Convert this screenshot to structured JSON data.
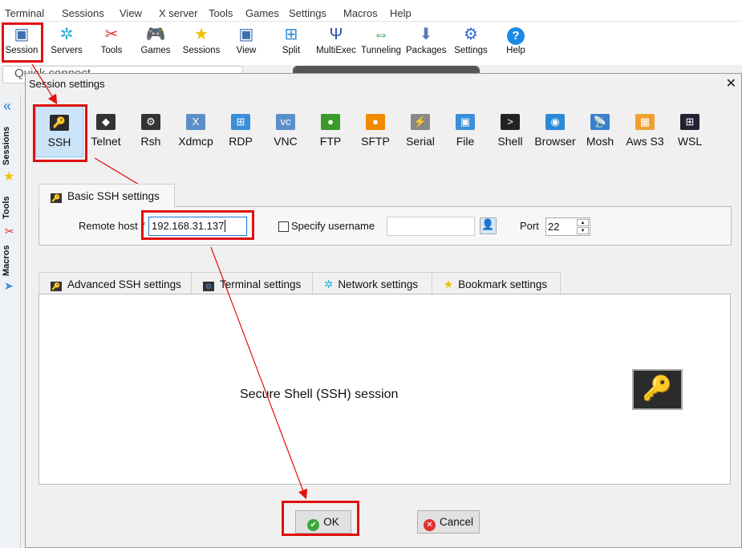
{
  "menu": [
    "Terminal",
    "Sessions",
    "View",
    "X server",
    "Tools",
    "Games",
    "Settings",
    "Macros",
    "Help"
  ],
  "toolbar": [
    {
      "label": "Session",
      "icon": "session-monitor-icon"
    },
    {
      "label": "Servers",
      "icon": "servers-icon"
    },
    {
      "label": "Tools",
      "icon": "tools-icon"
    },
    {
      "label": "Games",
      "icon": "gamepad-icon"
    },
    {
      "label": "Sessions",
      "icon": "star-icon"
    },
    {
      "label": "View",
      "icon": "view-icon"
    },
    {
      "label": "Split",
      "icon": "split-icon"
    },
    {
      "label": "MultiExec",
      "icon": "multiexec-icon"
    },
    {
      "label": "Tunneling",
      "icon": "tunneling-icon"
    },
    {
      "label": "Packages",
      "icon": "packages-icon"
    },
    {
      "label": "Settings",
      "icon": "settings-gears-icon"
    },
    {
      "label": "Help",
      "icon": "help-icon"
    }
  ],
  "quick_connect": "Quick connect...",
  "sidebar": {
    "sessions": "Sessions",
    "tools": "Tools",
    "macros": "Macros"
  },
  "dialog": {
    "title": "Session settings",
    "session_types": [
      {
        "label": "SSH",
        "color": "#2b2b2b",
        "glyph": "🔑"
      },
      {
        "label": "Telnet",
        "color": "#333",
        "glyph": "◆"
      },
      {
        "label": "Rsh",
        "color": "#333",
        "glyph": "⚙"
      },
      {
        "label": "Xdmcp",
        "color": "#5a8fc8",
        "glyph": "X"
      },
      {
        "label": "RDP",
        "color": "#3b8fd8",
        "glyph": "⊞"
      },
      {
        "label": "VNC",
        "color": "#5a8fc8",
        "glyph": "vc"
      },
      {
        "label": "FTP",
        "color": "#3a9a2a",
        "glyph": "●"
      },
      {
        "label": "SFTP",
        "color": "#f08a00",
        "glyph": "●"
      },
      {
        "label": "Serial",
        "color": "#888",
        "glyph": "⚡"
      },
      {
        "label": "File",
        "color": "#3b8fd8",
        "glyph": "▣"
      },
      {
        "label": "Shell",
        "color": "#222",
        "glyph": ">"
      },
      {
        "label": "Browser",
        "color": "#2a8ad8",
        "glyph": "◉"
      },
      {
        "label": "Mosh",
        "color": "#3b7fd0",
        "glyph": "📡"
      },
      {
        "label": "Aws S3",
        "color": "#f0a030",
        "glyph": "▦"
      },
      {
        "label": "WSL",
        "color": "#223",
        "glyph": "⊞"
      }
    ],
    "selected_type": "SSH",
    "basic_tab": "Basic SSH settings",
    "remote_host_label": "Remote host",
    "required_mark": "*",
    "remote_host_value": "192.168.31.137",
    "specify_username_label": "Specify username",
    "specify_username_checked": false,
    "username_value": "",
    "port_label": "Port",
    "port_value": "22",
    "sub_tabs": [
      "Advanced SSH settings",
      "Terminal settings",
      "Network settings",
      "Bookmark settings"
    ],
    "description": "Secure Shell (SSH) session",
    "ok_label": "OK",
    "cancel_label": "Cancel"
  },
  "annotation_color": "#e01010"
}
